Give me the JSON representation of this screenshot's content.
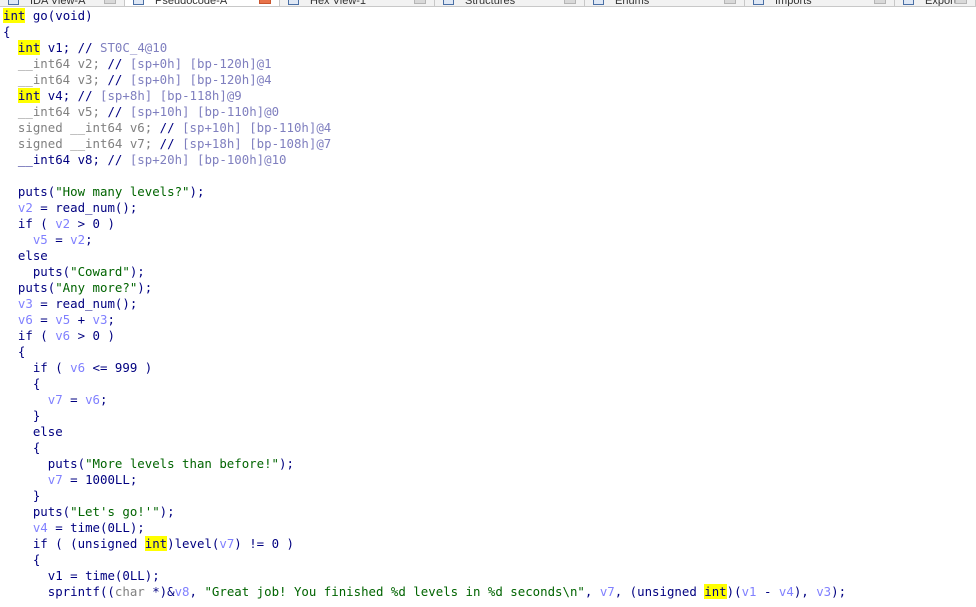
{
  "tabs": [
    {
      "label": "IDA View-A",
      "active": false
    },
    {
      "label": "Pseudocode-A",
      "active": true
    },
    {
      "label": "Hex View-1",
      "active": false
    },
    {
      "label": "Structures",
      "active": false
    },
    {
      "label": "Enums",
      "active": false
    },
    {
      "label": "Imports",
      "active": false
    },
    {
      "label": "Exports",
      "active": false
    }
  ],
  "colors": {
    "keyword": "#000080",
    "variable": "#8080ff",
    "string": "#006400",
    "comment": "#808080",
    "highlight": "#ffff00",
    "active_tab_close": "#e8734a"
  },
  "code": {
    "lines": [
      [
        {
          "t": "int",
          "c": "kh"
        },
        {
          "t": " go(void)",
          "c": "p"
        }
      ],
      [
        {
          "t": "{",
          "c": "p"
        }
      ],
      [
        {
          "t": "  ",
          "c": "p"
        },
        {
          "t": "int",
          "c": "kh"
        },
        {
          "t": " v1; ",
          "c": "p"
        },
        {
          "t": "// ",
          "c": "p"
        },
        {
          "t": "ST0C_4@10",
          "c": "cm"
        }
      ],
      [
        {
          "t": "  ",
          "c": "p"
        },
        {
          "t": "__int64",
          "c": "c"
        },
        {
          "t": " v2; ",
          "c": "c"
        },
        {
          "t": "// ",
          "c": "p"
        },
        {
          "t": "[sp+0h] [bp-120h]@1",
          "c": "cm"
        }
      ],
      [
        {
          "t": "  ",
          "c": "p"
        },
        {
          "t": "__int64",
          "c": "c"
        },
        {
          "t": " v3; ",
          "c": "c"
        },
        {
          "t": "// ",
          "c": "p"
        },
        {
          "t": "[sp+0h] [bp-120h]@4",
          "c": "cm"
        }
      ],
      [
        {
          "t": "  ",
          "c": "p"
        },
        {
          "t": "int",
          "c": "kh"
        },
        {
          "t": " v4; ",
          "c": "p"
        },
        {
          "t": "// ",
          "c": "p"
        },
        {
          "t": "[sp+8h] [bp-118h]@9",
          "c": "cm"
        }
      ],
      [
        {
          "t": "  ",
          "c": "p"
        },
        {
          "t": "__int64",
          "c": "c"
        },
        {
          "t": " v5; ",
          "c": "c"
        },
        {
          "t": "// ",
          "c": "p"
        },
        {
          "t": "[sp+10h] [bp-110h]@0",
          "c": "cm"
        }
      ],
      [
        {
          "t": "  ",
          "c": "p"
        },
        {
          "t": "signed __int64",
          "c": "c"
        },
        {
          "t": " v6; ",
          "c": "c"
        },
        {
          "t": "// ",
          "c": "p"
        },
        {
          "t": "[sp+10h] [bp-110h]@4",
          "c": "cm"
        }
      ],
      [
        {
          "t": "  ",
          "c": "p"
        },
        {
          "t": "signed __int64",
          "c": "c"
        },
        {
          "t": " v7; ",
          "c": "c"
        },
        {
          "t": "// ",
          "c": "p"
        },
        {
          "t": "[sp+18h] [bp-108h]@7",
          "c": "cm"
        }
      ],
      [
        {
          "t": "  ",
          "c": "p"
        },
        {
          "t": "__int64 v8; ",
          "c": "p"
        },
        {
          "t": "// ",
          "c": "p"
        },
        {
          "t": "[sp+20h] [bp-100h]@10",
          "c": "cm"
        }
      ],
      [],
      [
        {
          "t": "  puts(",
          "c": "p"
        },
        {
          "t": "\"How many levels?\"",
          "c": "s"
        },
        {
          "t": ");",
          "c": "p"
        }
      ],
      [
        {
          "t": "  ",
          "c": "p"
        },
        {
          "t": "v2",
          "c": "var"
        },
        {
          "t": " = read_num();",
          "c": "p"
        }
      ],
      [
        {
          "t": "  if ( ",
          "c": "p"
        },
        {
          "t": "v2",
          "c": "var"
        },
        {
          "t": " > 0 )",
          "c": "p"
        }
      ],
      [
        {
          "t": "    ",
          "c": "p"
        },
        {
          "t": "v5",
          "c": "var"
        },
        {
          "t": " = ",
          "c": "p"
        },
        {
          "t": "v2",
          "c": "var"
        },
        {
          "t": ";",
          "c": "p"
        }
      ],
      [
        {
          "t": "  else",
          "c": "p"
        }
      ],
      [
        {
          "t": "    puts(",
          "c": "p"
        },
        {
          "t": "\"Coward\"",
          "c": "s"
        },
        {
          "t": ");",
          "c": "p"
        }
      ],
      [
        {
          "t": "  puts(",
          "c": "p"
        },
        {
          "t": "\"Any more?\"",
          "c": "s"
        },
        {
          "t": ");",
          "c": "p"
        }
      ],
      [
        {
          "t": "  ",
          "c": "p"
        },
        {
          "t": "v3",
          "c": "var"
        },
        {
          "t": " = read_num();",
          "c": "p"
        }
      ],
      [
        {
          "t": "  ",
          "c": "p"
        },
        {
          "t": "v6",
          "c": "var"
        },
        {
          "t": " = ",
          "c": "p"
        },
        {
          "t": "v5",
          "c": "var"
        },
        {
          "t": " + ",
          "c": "p"
        },
        {
          "t": "v3",
          "c": "var"
        },
        {
          "t": ";",
          "c": "p"
        }
      ],
      [
        {
          "t": "  if ( ",
          "c": "p"
        },
        {
          "t": "v6",
          "c": "var"
        },
        {
          "t": " > 0 )",
          "c": "p"
        }
      ],
      [
        {
          "t": "  {",
          "c": "p"
        }
      ],
      [
        {
          "t": "    if ( ",
          "c": "p"
        },
        {
          "t": "v6",
          "c": "var"
        },
        {
          "t": " <= 999 )",
          "c": "p"
        }
      ],
      [
        {
          "t": "    {",
          "c": "p"
        }
      ],
      [
        {
          "t": "      ",
          "c": "p"
        },
        {
          "t": "v7",
          "c": "var"
        },
        {
          "t": " = ",
          "c": "p"
        },
        {
          "t": "v6",
          "c": "var"
        },
        {
          "t": ";",
          "c": "p"
        }
      ],
      [
        {
          "t": "    }",
          "c": "p"
        }
      ],
      [
        {
          "t": "    else",
          "c": "p"
        }
      ],
      [
        {
          "t": "    {",
          "c": "p"
        }
      ],
      [
        {
          "t": "      puts(",
          "c": "p"
        },
        {
          "t": "\"More levels than before!\"",
          "c": "s"
        },
        {
          "t": ");",
          "c": "p"
        }
      ],
      [
        {
          "t": "      ",
          "c": "p"
        },
        {
          "t": "v7",
          "c": "var"
        },
        {
          "t": " = 1000LL;",
          "c": "p"
        }
      ],
      [
        {
          "t": "    }",
          "c": "p"
        }
      ],
      [
        {
          "t": "    puts(",
          "c": "p"
        },
        {
          "t": "\"Let's go!'\"",
          "c": "s"
        },
        {
          "t": ");",
          "c": "p"
        }
      ],
      [
        {
          "t": "    ",
          "c": "p"
        },
        {
          "t": "v4",
          "c": "var"
        },
        {
          "t": " = time(0LL);",
          "c": "p"
        }
      ],
      [
        {
          "t": "    if ( (unsigned ",
          "c": "p"
        },
        {
          "t": "int",
          "c": "kh"
        },
        {
          "t": ")level(",
          "c": "p"
        },
        {
          "t": "v7",
          "c": "var"
        },
        {
          "t": ") != 0 )",
          "c": "p"
        }
      ],
      [
        {
          "t": "    {",
          "c": "p"
        }
      ],
      [
        {
          "t": "      ",
          "c": "p"
        },
        {
          "t": "v1",
          "c": "p"
        },
        {
          "t": " = time(0LL);",
          "c": "p"
        }
      ],
      [
        {
          "t": "      sprintf((",
          "c": "p"
        },
        {
          "t": "char",
          "c": "c"
        },
        {
          "t": " *)&",
          "c": "p"
        },
        {
          "t": "v8",
          "c": "var"
        },
        {
          "t": ", ",
          "c": "p"
        },
        {
          "t": "\"Great job! You finished %d levels in %d seconds\\n\"",
          "c": "s"
        },
        {
          "t": ", ",
          "c": "p"
        },
        {
          "t": "v7",
          "c": "var"
        },
        {
          "t": ", (unsigned ",
          "c": "p"
        },
        {
          "t": "int",
          "c": "kh"
        },
        {
          "t": ")(",
          "c": "p"
        },
        {
          "t": "v1",
          "c": "var"
        },
        {
          "t": " - ",
          "c": "p"
        },
        {
          "t": "v4",
          "c": "var"
        },
        {
          "t": "), ",
          "c": "p"
        },
        {
          "t": "v3",
          "c": "var"
        },
        {
          "t": ");",
          "c": "p"
        }
      ]
    ]
  }
}
